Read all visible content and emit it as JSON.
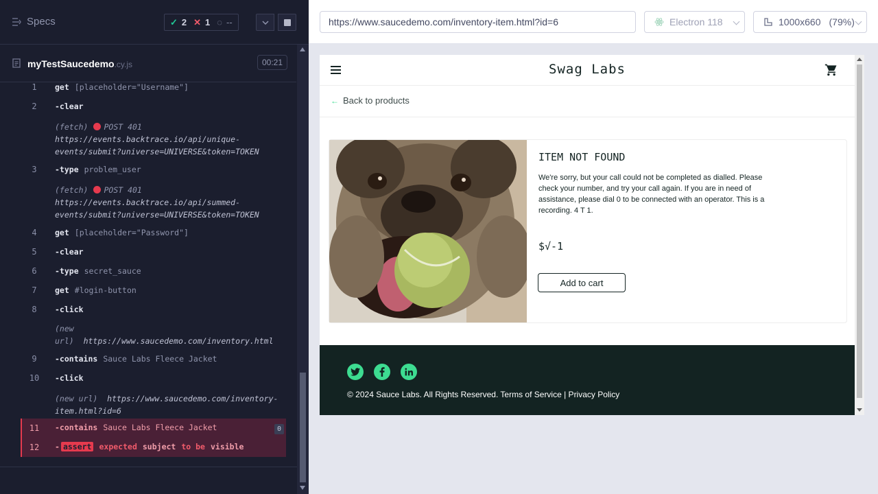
{
  "reporter": {
    "specs_label": "Specs",
    "stats": {
      "passed": "2",
      "failed": "1",
      "pending": "--"
    },
    "spec_name": "myTestSaucedemo",
    "spec_ext": ".cy.js",
    "duration": "00:21",
    "commands": [
      {
        "num": "1",
        "name": "get",
        "msg": "[placeholder=\"Username\"]"
      },
      {
        "num": "2",
        "name": "-clear",
        "msg": ""
      },
      {
        "label": "(fetch)",
        "method": "POST 401",
        "url": "https://events.backtrace.io/api/unique-events/submit?universe=UNIVERSE&token=TOKEN"
      },
      {
        "num": "3",
        "name": "-type",
        "msg": "problem_user"
      },
      {
        "label": "(fetch)",
        "method": "POST 401",
        "url": "https://events.backtrace.io/api/summed-events/submit?universe=UNIVERSE&token=TOKEN"
      },
      {
        "num": "4",
        "name": "get",
        "msg": "[placeholder=\"Password\"]"
      },
      {
        "num": "5",
        "name": "-clear",
        "msg": ""
      },
      {
        "num": "6",
        "name": "-type",
        "msg": "secret_sauce"
      },
      {
        "num": "7",
        "name": "get",
        "msg": "#login-button"
      },
      {
        "num": "8",
        "name": "-click",
        "msg": ""
      },
      {
        "label": "(new url)",
        "url": "https://www.saucedemo.com/inventory.html"
      },
      {
        "num": "9",
        "name": "-contains",
        "msg": "Sauce Labs Fleece Jacket"
      },
      {
        "num": "10",
        "name": "-click",
        "msg": ""
      },
      {
        "label": "(new url)",
        "url": "https://www.saucedemo.com/inventory-item.html?id=6"
      },
      {
        "num": "11",
        "name": "-contains",
        "msg": "Sauce Labs Fleece Jacket",
        "badge": "0"
      },
      {
        "num": "12",
        "name": "-",
        "tag": "assert",
        "words": [
          "expected",
          "subject",
          "to be",
          "visible"
        ]
      }
    ]
  },
  "aut": {
    "url": "https://www.saucedemo.com/inventory-item.html?id=6",
    "browser": "Electron 118",
    "viewport": "1000x660",
    "zoom": "(79%)"
  },
  "page": {
    "logo": "Swag Labs",
    "back_label": "Back to products",
    "item_title": "ITEM NOT FOUND",
    "item_desc": "We're sorry, but your call could not be completed as dialled. Please check your number, and try your call again. If you are in need of assistance, please dial 0 to be connected with an operator. This is a recording. 4 T 1.",
    "item_price": "$√-1",
    "add_to_cart": "Add to cart",
    "footer": "© 2024 Sauce Labs. All Rights Reserved. Terms of Service | Privacy Policy"
  },
  "colors": {
    "reporter_bg": "#1b1e2e",
    "pass": "#20c996",
    "fail": "#e63a4e",
    "sauce_dark": "#132322",
    "sauce_green": "#3ddc91"
  }
}
